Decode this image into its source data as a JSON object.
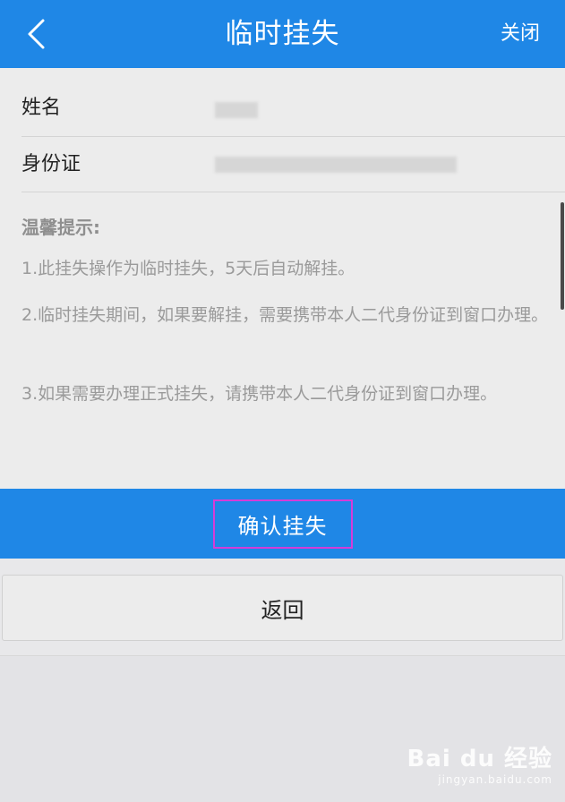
{
  "header": {
    "title": "临时挂失",
    "close_label": "关闭"
  },
  "fields": {
    "name_label": "姓名",
    "id_label": "身份证"
  },
  "tips": {
    "title": "温馨提示:",
    "items": [
      "1.此挂失操作为临时挂失，5天后自动解挂。",
      "2.临时挂失期间，如果要解挂，需要携带本人二代身份证到窗口办理。",
      "3.如果需要办理正式挂失，请携带本人二代身份证到窗口办理。"
    ]
  },
  "buttons": {
    "confirm_label": "确认挂失",
    "back_label": "返回"
  },
  "watermark": {
    "logo": "Bai du 经验",
    "url": "jingyan.baidu.com"
  },
  "colors": {
    "primary": "#1f87e6",
    "highlight": "#d63cd8"
  }
}
